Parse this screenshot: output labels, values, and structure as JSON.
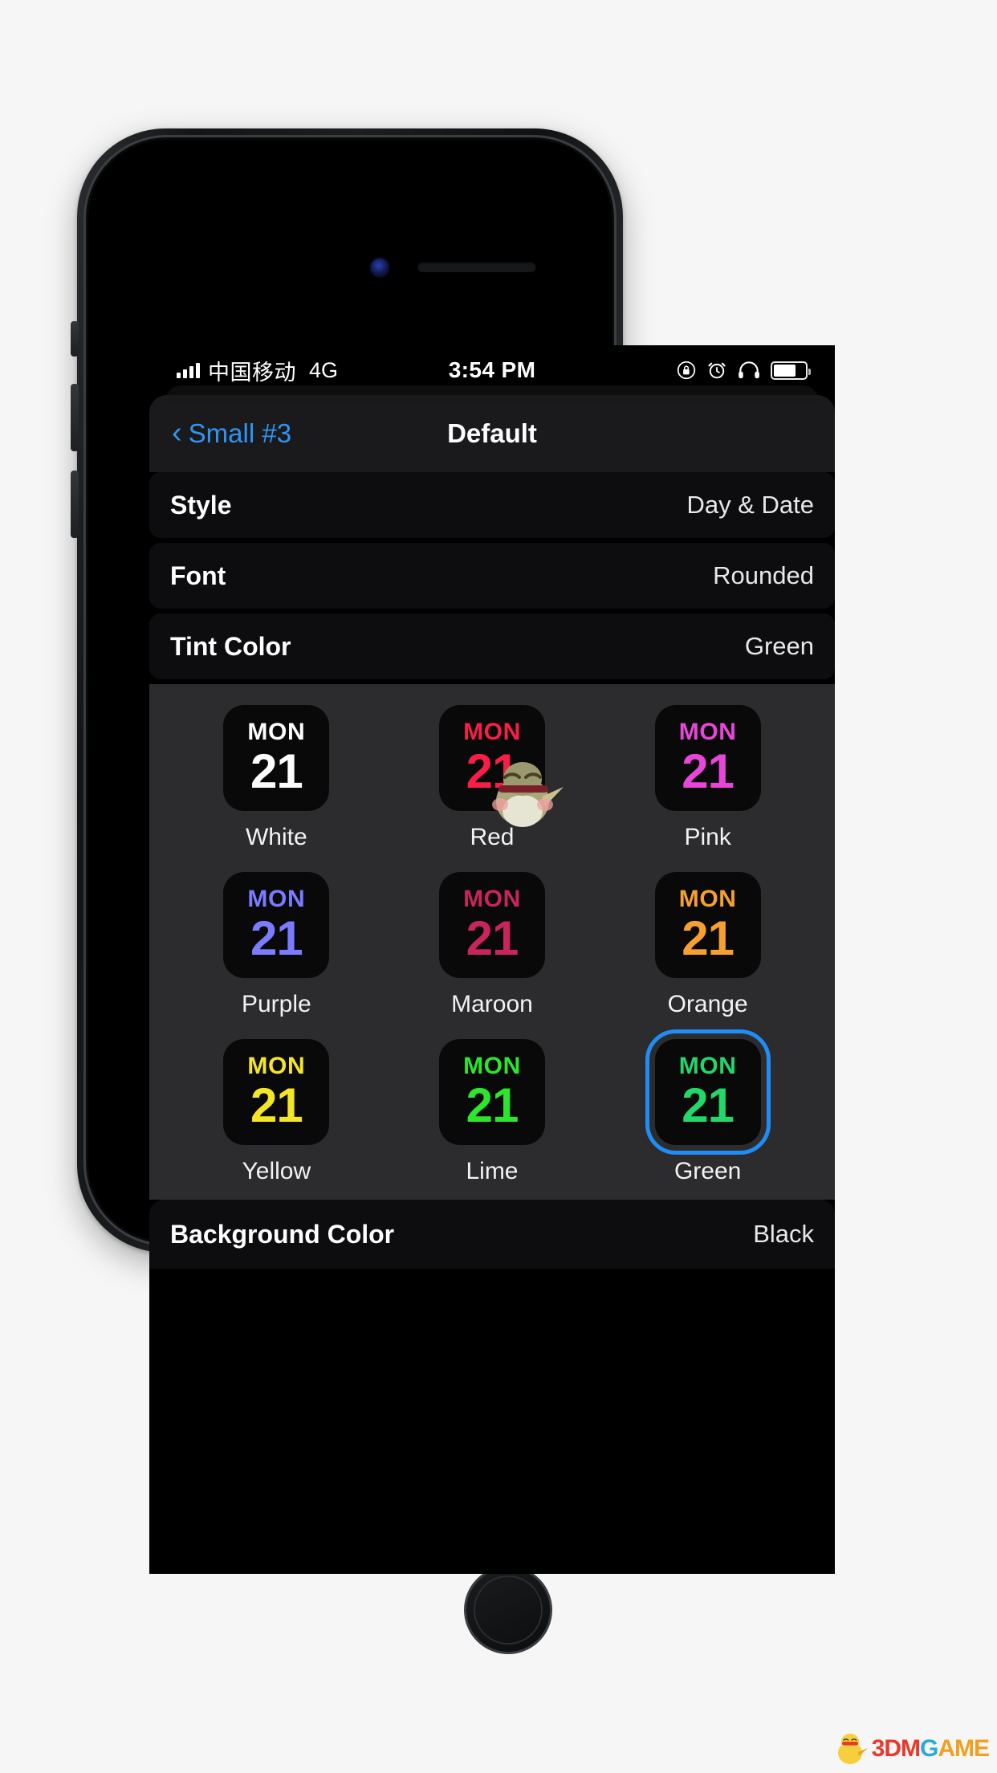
{
  "status_bar": {
    "carrier": "中国移动",
    "network": "4G",
    "time": "3:54 PM",
    "icons": [
      "rotation-lock-icon",
      "alarm-clock-icon",
      "headphones-icon",
      "battery-icon"
    ],
    "battery_level_percent": 72
  },
  "nav_bar": {
    "back_label": "Small #3",
    "back_icon": "chevron-left-icon",
    "title": "Default"
  },
  "settings_rows": [
    {
      "label": "Style",
      "value": "Day & Date"
    },
    {
      "label": "Font",
      "value": "Rounded"
    },
    {
      "label": "Tint Color",
      "value": "Green"
    }
  ],
  "tint_color_grid": {
    "preview_day": "MON",
    "preview_date": "21",
    "selected": "Green",
    "selection_ring_color": "#1f8df5",
    "swatch_background": "#090909",
    "options": [
      {
        "name": "White",
        "color": "#ffffff"
      },
      {
        "name": "Red",
        "color": "#f71e47"
      },
      {
        "name": "Pink",
        "color": "#e846d8"
      },
      {
        "name": "Purple",
        "color": "#7b7bff"
      },
      {
        "name": "Maroon",
        "color": "#c8255c"
      },
      {
        "name": "Orange",
        "color": "#f5a030"
      },
      {
        "name": "Yellow",
        "color": "#f5e625"
      },
      {
        "name": "Lime",
        "color": "#2be62b"
      },
      {
        "name": "Green",
        "color": "#22d86a"
      }
    ]
  },
  "bottom_row": {
    "label": "Background Color",
    "value": "Black"
  },
  "watermark": {
    "part1": "3DM",
    "part2": "G",
    "part3": "AME"
  }
}
